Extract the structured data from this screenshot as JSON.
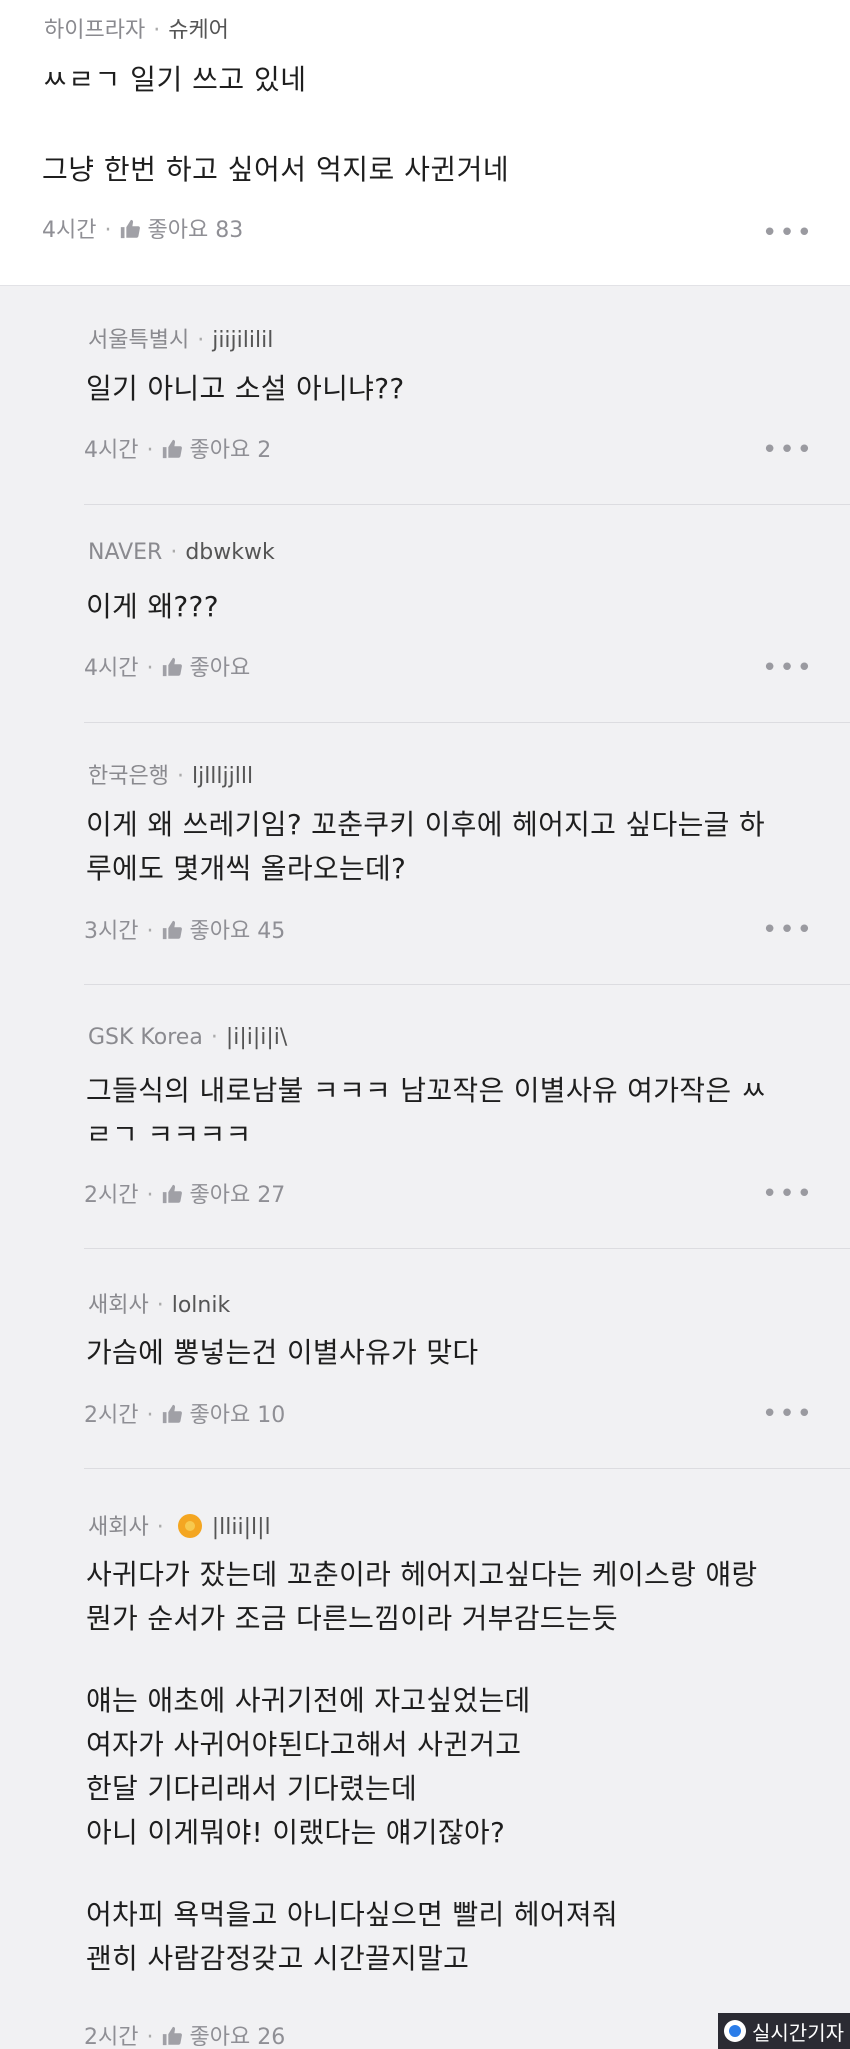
{
  "top": {
    "source": "하이프라자",
    "nickname": "슈케어",
    "line1": "ㅆㄹㄱ 일기 쓰고 있네",
    "line2": "그냥 한번 하고 싶어서 억지로 사귄거네",
    "time": "4시간",
    "like_label": "좋아요 83",
    "more_label": "•••"
  },
  "replies": [
    {
      "source": "서울특별시",
      "nickname": "jiijililil",
      "lines": [
        "일기 아니고 소설 아니냐??"
      ],
      "time": "4시간",
      "like_label": "좋아요 2",
      "more_label": "•••"
    },
    {
      "source": "NAVER",
      "nickname": "dbwkwk",
      "lines": [
        "이게 왜???"
      ],
      "time": "4시간",
      "like_label": "좋아요",
      "more_label": "•••"
    },
    {
      "source": "한국은행",
      "nickname": "ljllljjlll",
      "lines": [
        "이게 왜 쓰레기임? 꼬춘쿠키 이후에 헤어지고 싶다는글 하",
        "루에도 몇개씩 올라오는데?"
      ],
      "time": "3시간",
      "like_label": "좋아요 45",
      "more_label": "•••"
    },
    {
      "source": "GSK Korea",
      "nickname": "|i|i|i|i\\",
      "lines": [
        "그들식의 내로남불 ㅋㅋㅋ 남꼬작은 이별사유 여가작은 ㅆ",
        "ㄹㄱ ㅋㅋㅋㅋ"
      ],
      "time": "2시간",
      "like_label": "좋아요 27",
      "more_label": "•••"
    },
    {
      "source": "새회사",
      "nickname": "lolnik",
      "lines": [
        "가슴에 뽕넣는건 이별사유가 맞다"
      ],
      "time": "2시간",
      "like_label": "좋아요 10",
      "more_label": "•••"
    },
    {
      "source": "새회사",
      "nickname": "|llii|l|l",
      "lines": [
        "사귀다가 잤는데 꼬춘이라 헤어지고싶다는 케이스랑 얘랑",
        "뭔가 순서가 조금 다른느낌이라 거부감드는듯",
        "",
        "얘는 애초에 사귀기전에 자고싶었는데",
        "여자가 사귀어야된다고해서 사귄거고",
        "한달 기다리래서 기다렸는데",
        "아니 이게뭐야! 이랬다는 얘기잖아?",
        "",
        "어차피 욕먹을고 아니다싶으면 빨리 헤어져줘",
        "괜히 사람감정갖고 시간끌지말고"
      ],
      "time": "2시간",
      "like_label": "좋아요 26",
      "more_label": "•••"
    }
  ],
  "watermark": {
    "label": "실시간기자"
  },
  "colors": {
    "meta": "#8a8a8f",
    "text": "#1e1e1e",
    "bg": "#f1f1f3",
    "badge": "#f4a621"
  }
}
